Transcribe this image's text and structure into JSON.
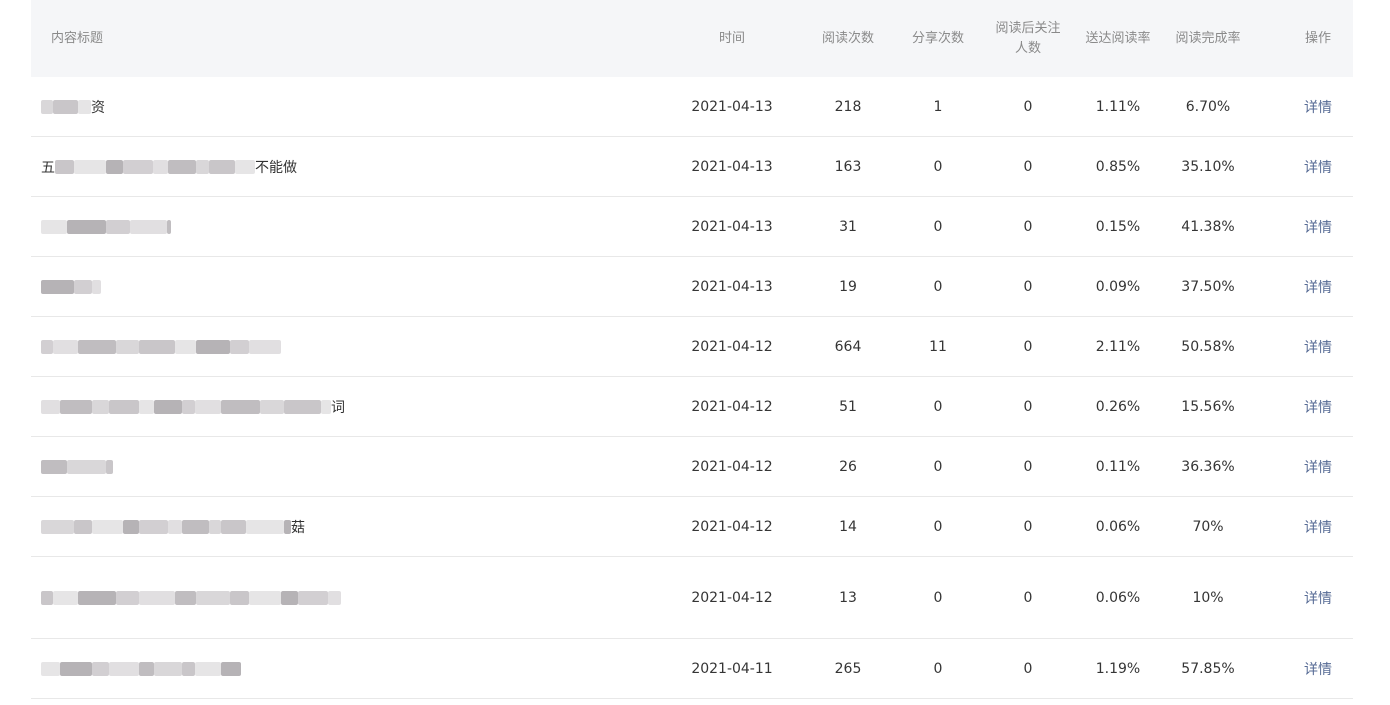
{
  "headers": {
    "title": "内容标题",
    "time": "时间",
    "reads": "阅读次数",
    "shares": "分享次数",
    "follow_l1": "阅读后关注",
    "follow_l2": "人数",
    "reach": "送达阅读率",
    "complete": "阅读完成率",
    "action": "操作"
  },
  "rows": [
    {
      "title_start": "",
      "title_end": "资",
      "date": "2021-04-13",
      "reads": "218",
      "shares": "1",
      "follows": "0",
      "reach": "1.11%",
      "complete": "6.70%",
      "action": "详情"
    },
    {
      "title_start": "五",
      "title_end": "不能做",
      "date": "2021-04-13",
      "reads": "163",
      "shares": "0",
      "follows": "0",
      "reach": "0.85%",
      "complete": "35.10%",
      "action": "详情"
    },
    {
      "title_start": "",
      "title_end": "",
      "date": "2021-04-13",
      "reads": "31",
      "shares": "0",
      "follows": "0",
      "reach": "0.15%",
      "complete": "41.38%",
      "action": "详情"
    },
    {
      "title_start": "",
      "title_end": "",
      "date": "2021-04-13",
      "reads": "19",
      "shares": "0",
      "follows": "0",
      "reach": "0.09%",
      "complete": "37.50%",
      "action": "详情"
    },
    {
      "title_start": "",
      "title_end": "",
      "date": "2021-04-12",
      "reads": "664",
      "shares": "11",
      "follows": "0",
      "reach": "2.11%",
      "complete": "50.58%",
      "action": "详情"
    },
    {
      "title_start": "",
      "title_end": "词",
      "date": "2021-04-12",
      "reads": "51",
      "shares": "0",
      "follows": "0",
      "reach": "0.26%",
      "complete": "15.56%",
      "action": "详情"
    },
    {
      "title_start": "",
      "title_end": "",
      "date": "2021-04-12",
      "reads": "26",
      "shares": "0",
      "follows": "0",
      "reach": "0.11%",
      "complete": "36.36%",
      "action": "详情"
    },
    {
      "title_start": "",
      "title_end": "菇",
      "date": "2021-04-12",
      "reads": "14",
      "shares": "0",
      "follows": "0",
      "reach": "0.06%",
      "complete": "70%",
      "action": "详情"
    },
    {
      "title_start": "",
      "title_end": "",
      "date": "2021-04-12",
      "reads": "13",
      "shares": "0",
      "follows": "0",
      "reach": "0.06%",
      "complete": "10%",
      "action": "详情"
    },
    {
      "title_start": "",
      "title_end": "",
      "date": "2021-04-11",
      "reads": "265",
      "shares": "0",
      "follows": "0",
      "reach": "1.19%",
      "complete": "57.85%",
      "action": "详情"
    }
  ]
}
